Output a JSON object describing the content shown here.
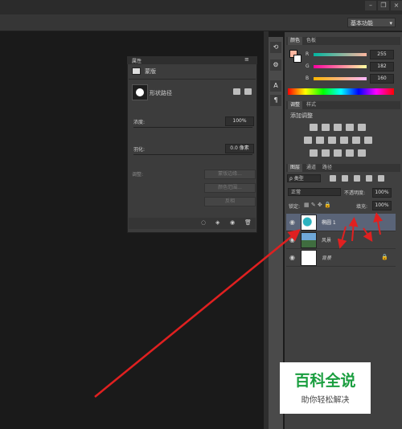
{
  "workspace": {
    "label": "基本功能"
  },
  "color_panel": {
    "tabs": [
      "颜色",
      "色板"
    ],
    "channels": [
      {
        "name": "R",
        "value": "255"
      },
      {
        "name": "G",
        "value": "182"
      },
      {
        "name": "B",
        "value": "160"
      }
    ]
  },
  "adjust_panel": {
    "tabs": [
      "调整",
      "样式"
    ],
    "title": "添加调整"
  },
  "layers_panel": {
    "tabs": [
      "图层",
      "通道",
      "路径"
    ],
    "kind_filter": "ρ 类型",
    "blend_mode": "正常",
    "opacity_label": "不透明度:",
    "opacity_value": "100%",
    "lock_label": "锁定:",
    "fill_label": "填充:",
    "fill_value": "100%",
    "layers": [
      {
        "name": "椭圆 1",
        "selected": true
      },
      {
        "name": "风景",
        "selected": false
      },
      {
        "name": "背景",
        "selected": false,
        "locked": true
      }
    ]
  },
  "properties": {
    "header": "属性",
    "mask_label": "蒙版",
    "shape_label": "形状路径",
    "density_label": "浓度:",
    "density_value": "100%",
    "feather_label": "羽化:",
    "feather_value": "0.0 像素",
    "refine_label": "调整:",
    "btn_mask_edge": "蒙版边缘...",
    "btn_color_range": "颜色范围...",
    "btn_invert": "反相"
  },
  "logo": {
    "title": "百科全说",
    "subtitle": "助你轻松解决"
  },
  "colors": {
    "arrow": "#e02020",
    "brand": "#1a9e3f",
    "foreground": "#ffb6a0"
  }
}
